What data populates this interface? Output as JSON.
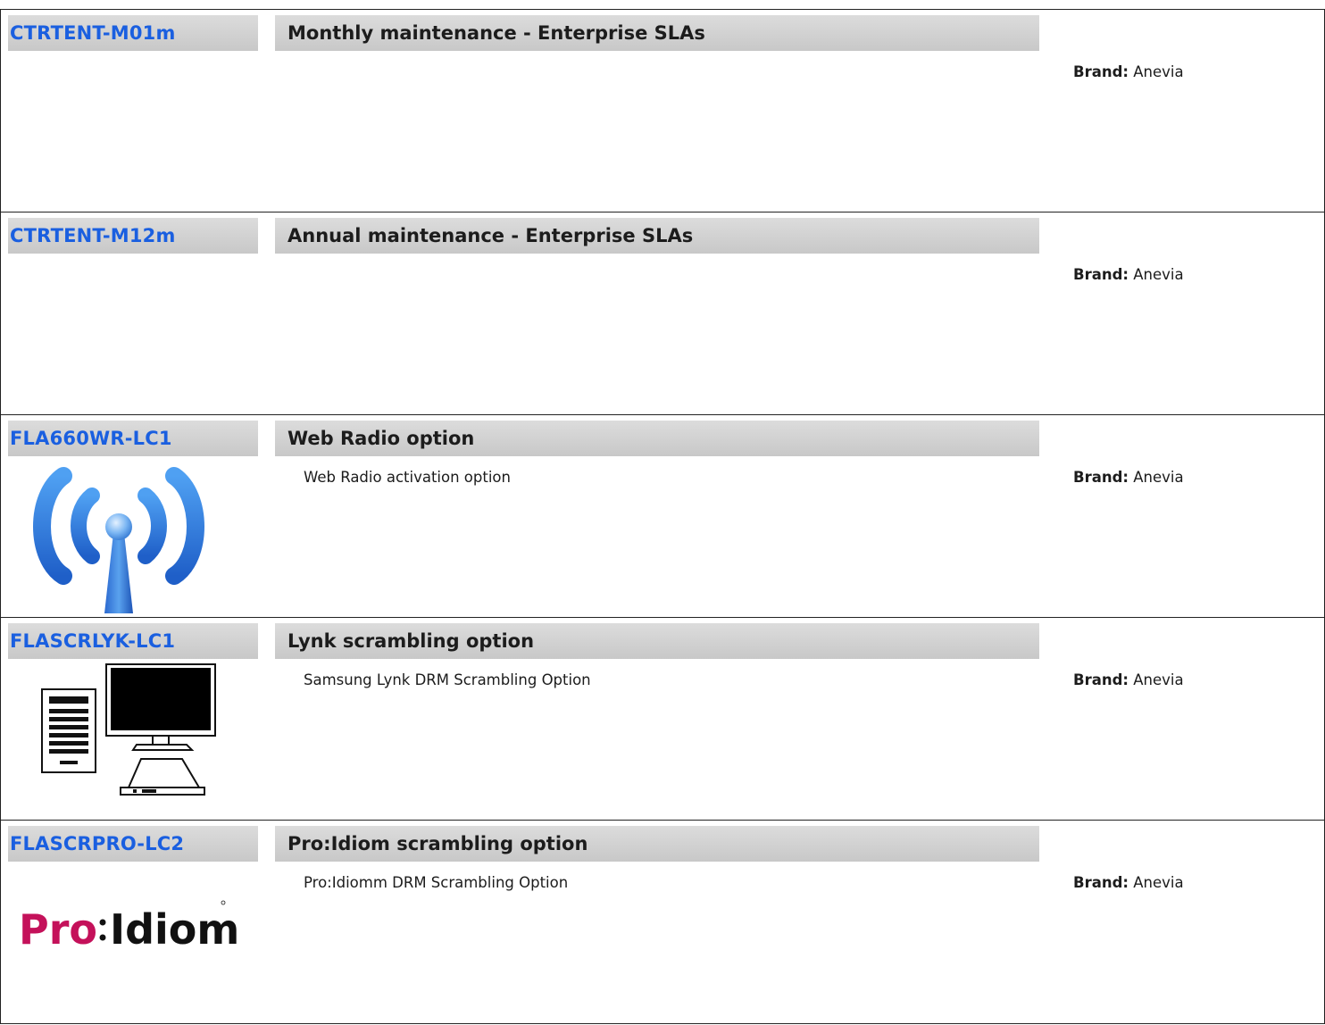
{
  "products": [
    {
      "sku": "CTRTENT-M01m",
      "title": "Monthly maintenance - Enterprise SLAs",
      "description": "",
      "brand_label": "Brand:",
      "brand_value": "Anevia"
    },
    {
      "sku": "CTRTENT-M12m",
      "title": "Annual maintenance - Enterprise SLAs",
      "description": "",
      "brand_label": "Brand:",
      "brand_value": "Anevia"
    },
    {
      "sku": "FLA660WR-LC1",
      "title": "Web Radio option",
      "description": "Web Radio activation option",
      "brand_label": "Brand:",
      "brand_value": "Anevia",
      "icon": "wifi-antenna-icon"
    },
    {
      "sku": "FLASCRLYK-LC1",
      "title": "Lynk scrambling option",
      "description": "Samsung Lynk DRM Scrambling Option",
      "brand_label": "Brand:",
      "brand_value": "Anevia",
      "icon": "server-monitor-settopbox-icon"
    },
    {
      "sku": "FLASCRPRO-LC2",
      "title": "Pro:Idiom scrambling option",
      "description": "Pro:Idiomm DRM Scrambling Option",
      "brand_label": "Brand:",
      "brand_value": "Anevia",
      "logo_text": "Pro:Idiom"
    }
  ],
  "colors": {
    "sku_link": "#1a5fe0",
    "header_bg": "#d2d2d2",
    "logo": "#c4115a"
  }
}
